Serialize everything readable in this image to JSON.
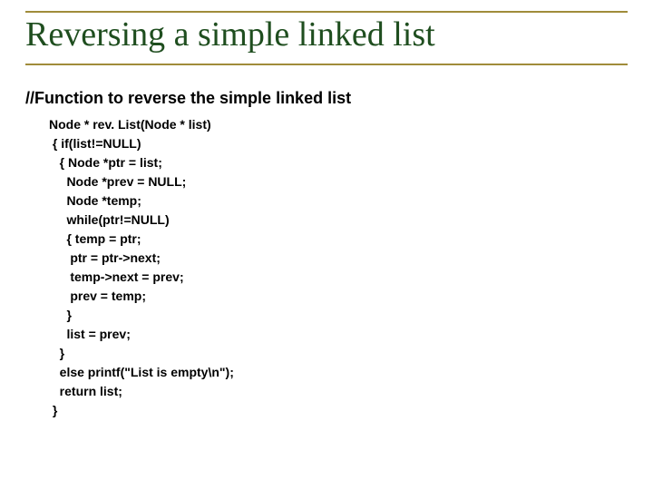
{
  "title": "Reversing a simple linked list",
  "subhead": "//Function to reverse the simple linked list",
  "code": "Node * rev. List(Node * list)\n { if(list!=NULL)\n   { Node *ptr = list;\n     Node *prev = NULL;\n     Node *temp;\n     while(ptr!=NULL)\n     { temp = ptr;\n      ptr = ptr->next;\n      temp->next = prev;\n      prev = temp;\n     }\n     list = prev;\n   }\n   else printf(\"List is empty\\n\");\n   return list;\n }"
}
